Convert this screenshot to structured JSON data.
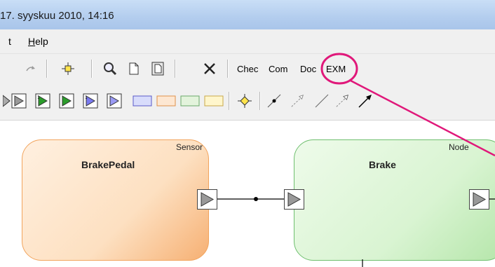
{
  "window": {
    "title": "17. syyskuu 2010, 14:16"
  },
  "menu": [
    {
      "label": "t",
      "key": ""
    },
    {
      "label": "elp",
      "key": "H"
    }
  ],
  "toolbar1": {
    "buttons": [
      "redo-icon",
      "add-port-icon",
      "zoom-icon",
      "new-document-icon",
      "document-icon",
      "delete-icon"
    ],
    "text_buttons": [
      "Chec",
      "Com",
      "Doc",
      "EXM"
    ]
  },
  "toolbar2": {
    "tools": [
      "port-tool",
      "in-port-tool",
      "in-port-green-tool",
      "in-port-green-outline-tool",
      "in-port-blue-tool",
      "in-port-blue-outline-tool",
      "rect-blue-tool",
      "rect-orange-tool",
      "rect-green-tool",
      "rect-yellow-tool",
      "junction-tool",
      "connector-dot-tool",
      "connector-dashed-arrow-tool",
      "connector-line-tool",
      "connector-dashed-open-arrow-tool",
      "connector-arrow-tool"
    ]
  },
  "diagram": {
    "nodes": [
      {
        "type": "Sensor",
        "name": "BrakePedal",
        "color": "#f6b073"
      },
      {
        "type": "Node",
        "name": "Brake",
        "color": "#b5e6aa"
      }
    ]
  },
  "annotation": {
    "color": "#e0187a",
    "highlights": "EXM"
  }
}
